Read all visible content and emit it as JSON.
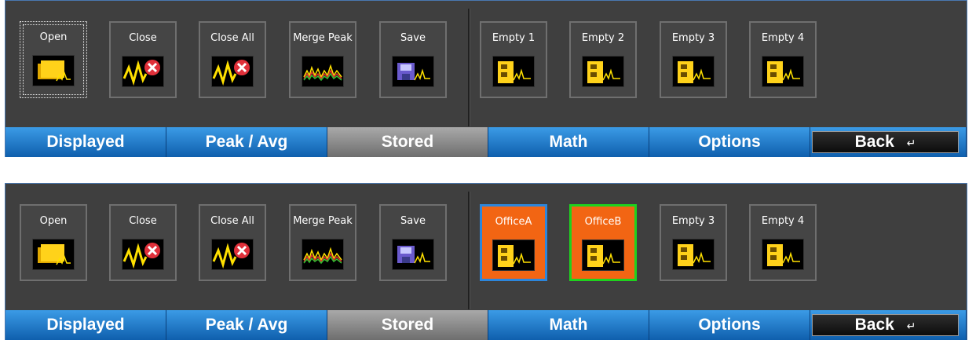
{
  "panels": [
    {
      "buttons": [
        {
          "label": "Open",
          "icon": "open-folder-icon"
        },
        {
          "label": "Close",
          "icon": "close-trace-icon"
        },
        {
          "label": "Close All",
          "icon": "close-all-trace-icon"
        },
        {
          "label": "Merge Peak",
          "icon": "merge-peak-icon"
        },
        {
          "label": "Save",
          "icon": "save-disk-icon"
        },
        {
          "label": "Empty 1",
          "icon": "storage-cabinet-icon"
        },
        {
          "label": "Empty 2",
          "icon": "storage-cabinet-icon"
        },
        {
          "label": "Empty 3",
          "icon": "storage-cabinet-icon"
        },
        {
          "label": "Empty 4",
          "icon": "storage-cabinet-icon"
        }
      ],
      "tabs": [
        "Displayed",
        "Peak / Avg",
        "Stored",
        "Math",
        "Options"
      ],
      "active_tab": "Stored",
      "back_label": "Back",
      "back_icon": "↵"
    },
    {
      "buttons": [
        {
          "label": "Open",
          "icon": "open-folder-icon"
        },
        {
          "label": "Close",
          "icon": "close-trace-icon"
        },
        {
          "label": "Close All",
          "icon": "close-all-trace-icon"
        },
        {
          "label": "Merge Peak",
          "icon": "merge-peak-icon"
        },
        {
          "label": "Save",
          "icon": "save-disk-icon"
        },
        {
          "label": "OfficeA",
          "icon": "storage-cabinet-icon",
          "highlight": "#f26513",
          "border": "#2c86dc"
        },
        {
          "label": "OfficeB",
          "icon": "storage-cabinet-icon",
          "highlight": "#f26513",
          "border": "#1ed21e"
        },
        {
          "label": "Empty 3",
          "icon": "storage-cabinet-icon"
        },
        {
          "label": "Empty 4",
          "icon": "storage-cabinet-icon"
        }
      ],
      "tabs": [
        "Displayed",
        "Peak / Avg",
        "Stored",
        "Math",
        "Options"
      ],
      "active_tab": "Stored",
      "back_label": "Back",
      "back_icon": "↵"
    }
  ]
}
